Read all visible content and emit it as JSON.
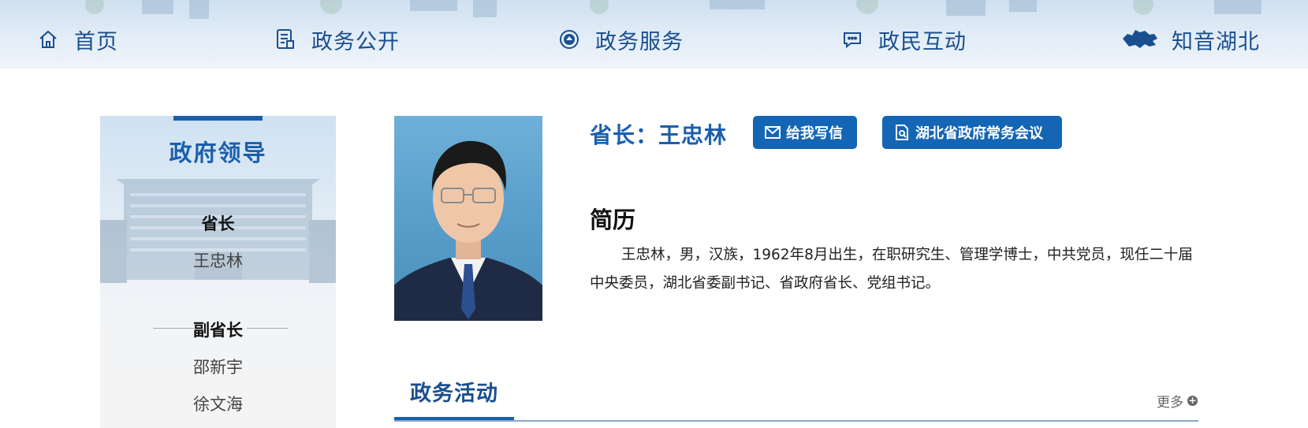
{
  "nav": {
    "home": "首页",
    "open_government": "政务公开",
    "government_services": "政务服务",
    "interaction": "政民互动",
    "zhiyin_hubei": "知音湖北",
    "icons": [
      "home-icon",
      "document-list-icon",
      "service-emblem-icon",
      "chat-bubble-icon",
      "hubei-map-icon"
    ]
  },
  "sidebar": {
    "title": "政府领导",
    "governor_label": "省长",
    "governor_name": "王忠林",
    "vice_label": "副省长",
    "vice_names": [
      "邵新宇",
      "徐文海"
    ]
  },
  "profile": {
    "title": "省长：王忠林",
    "write_letter_button": "给我写信",
    "meeting_button": "湖北省政府常务会议",
    "bio_heading": "简历",
    "bio_text": "王忠林，男，汉族，1962年8月出生，在职研究生、管理学博士，中共党员，现任二十届中央委员，湖北省委副书记、省政府省长、党组书记。"
  },
  "activities": {
    "tab_label": "政务活动",
    "more_label": "更多"
  },
  "colors": {
    "brand_blue": "#1a5fad",
    "button_blue": "#1565b5",
    "nav_text": "#1a4f8f"
  }
}
